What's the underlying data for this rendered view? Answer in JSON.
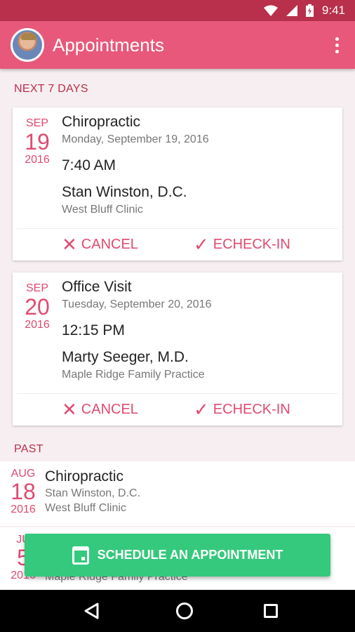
{
  "status_bar": {
    "time": "9:41",
    "battery_level": "charging"
  },
  "app_bar": {
    "title": "Appointments"
  },
  "sections": {
    "upcoming": "NEXT 7 DAYS",
    "past": "PAST"
  },
  "upcoming": [
    {
      "month": "SEP",
      "day": "19",
      "year": "2016",
      "type": "Chiropractic",
      "date": "Monday, September 19, 2016",
      "time": "7:40 AM",
      "provider": "Stan Winston, D.C.",
      "clinic": "West Bluff Clinic",
      "cancel_label": "CANCEL",
      "checkin_label": "ECHECK-IN"
    },
    {
      "month": "SEP",
      "day": "20",
      "year": "2016",
      "type": "Office Visit",
      "date": "Tuesday, September 20, 2016",
      "time": "12:15 PM",
      "provider": "Marty Seeger, M.D.",
      "clinic": "Maple Ridge Family Practice",
      "cancel_label": "CANCEL",
      "checkin_label": "ECHECK-IN"
    }
  ],
  "past": [
    {
      "month": "AUG",
      "day": "18",
      "year": "2016",
      "type": "Chiropractic",
      "provider": "Stan Winston, D.C.",
      "clinic": "West Bluff Clinic"
    },
    {
      "month": "JU",
      "day": "5",
      "year": "2016",
      "clinic": "Maple Ridge Family Practice"
    }
  ],
  "fab": {
    "label": "SCHEDULE AN APPOINTMENT"
  },
  "icons": {
    "cancel": "close-icon",
    "checkin": "echeck-icon",
    "schedule": "calendar-icon"
  },
  "colors": {
    "primary": "#e8587a",
    "status": "#b8304c",
    "accent": "#e04a70",
    "fab": "#34c97c"
  }
}
